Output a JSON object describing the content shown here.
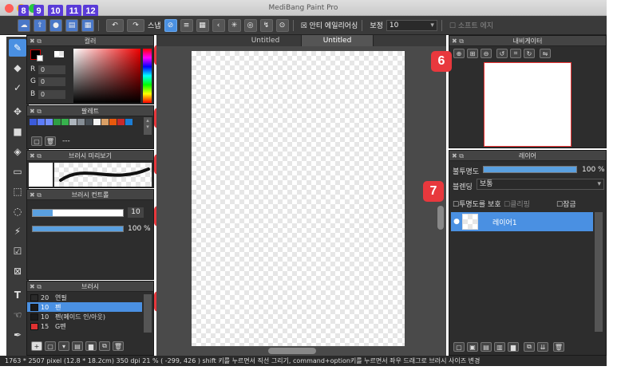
{
  "window": {
    "title": "MediBang Paint Pro"
  },
  "markers": {
    "top": [
      "8",
      "9",
      "10",
      "11",
      "12"
    ],
    "panels": [
      "1",
      "2",
      "3",
      "4",
      "5",
      "6",
      "7"
    ]
  },
  "toolbar": {
    "snap_label": "스냅",
    "antialias_label": "안티 에일리어싱",
    "correction_label": "보정",
    "correction_value": "10",
    "soft_edge_label": "소프트 에지"
  },
  "panels": {
    "color": {
      "title": "컬러",
      "r_label": "R",
      "g_label": "G",
      "b_label": "B",
      "r": "0",
      "g": "0",
      "b": "0",
      "colors": [
        "#000000",
        "#ffffff"
      ]
    },
    "palette": {
      "title": "팔레트",
      "dash": "---",
      "swatches": [
        "#3b5bdb",
        "#5c7cfa",
        "#748ffc",
        "#2f9e44",
        "#37b24d",
        "#adb5bd",
        "#868e96",
        "#495057",
        "#f5f5f5",
        "#d9a066",
        "#e8590c",
        "#c92a2a",
        "#1c7ed6"
      ]
    },
    "brush_preview": {
      "title": "브러시 미리보기"
    },
    "brush_control": {
      "title": "브러시 컨트롤",
      "size": "10",
      "opacity": "100 %",
      "size_fraction": 0.22,
      "opacity_fraction": 1.0
    },
    "brush": {
      "title": "브러시",
      "items": [
        {
          "size": "20",
          "name": "연필",
          "color": "#2a2a2a"
        },
        {
          "size": "10",
          "name": "펜",
          "color": "#1a1a1a"
        },
        {
          "size": "10",
          "name": "펜(페이드 인/아웃)",
          "color": "#1a1a1a"
        },
        {
          "size": "15",
          "name": "G펜",
          "color": "#e03131"
        }
      ]
    },
    "navigator": {
      "title": "내비게이터"
    },
    "layer": {
      "title": "레이어",
      "opacity_label": "불투명도",
      "opacity_value": "100 %",
      "opacity_fraction": 1.0,
      "blend_label": "블렌딩",
      "blend_value": "보통",
      "protect_label": "투명도를 보호",
      "clipping_label": "클리핑",
      "lock_label": "잠금",
      "layer_name": "레이어1"
    }
  },
  "canvas": {
    "tabs": [
      "Untitled",
      "Untitled"
    ]
  },
  "status": {
    "text": "1763 * 2507 pixel  (12.8 * 18.2cm)  350 dpi   21 %   ( -299, 426 )   shift 키를 누르면서 직선 그리기, command+option키를 누르면서 좌우 드래그로 브러시 사이즈 변경"
  }
}
